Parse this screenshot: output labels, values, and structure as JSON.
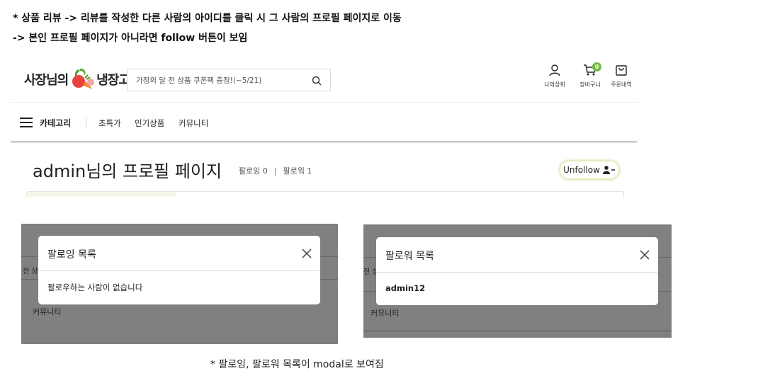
{
  "notes": {
    "line1": "* 상품 리뷰 -> 리뷰를 작성한 다른 사람의 아이디를 클릭 시 그 사람의 프로필 페이지로 이동",
    "line2": "-> 본인 프로필 페이지가 아니라면 follow 버튼이 보임",
    "footnote": "* 팔로잉, 팔로워 목록이 modal로 보여짐"
  },
  "header": {
    "logo_left": "사장님의",
    "logo_right": "냉장고",
    "search_placeholder": "가정의 달 전 상품 쿠폰팩 증정!(~5/21)",
    "icons": [
      {
        "name": "user-icon",
        "label": "나의상회"
      },
      {
        "name": "cart-icon",
        "label": "장바구니",
        "badge": "0"
      },
      {
        "name": "order-icon",
        "label": "주문내역"
      }
    ],
    "accent_color": "#6dbb3f"
  },
  "nav": {
    "category_label": "카테고리",
    "links": [
      "초특가",
      "인기상품",
      "커뮤니티"
    ]
  },
  "profile": {
    "title": "admin님의 프로필 페이지",
    "following_label": "팔로잉 0",
    "divider": "|",
    "follower_label": "팔로워 1",
    "unfollow_button": "Unfollow"
  },
  "following_modal": {
    "title": "팔로잉 목록",
    "message": "팔로우하는 사람이 없습니다",
    "bg_fragment_side": "전 상",
    "bg_fragment_nav": "커뮤니티"
  },
  "follower_modal": {
    "title": "팔로워 목록",
    "follower": "admin12",
    "bg_fragment_side": "전 상",
    "bg_fragment_nav": "커뮤니티"
  }
}
